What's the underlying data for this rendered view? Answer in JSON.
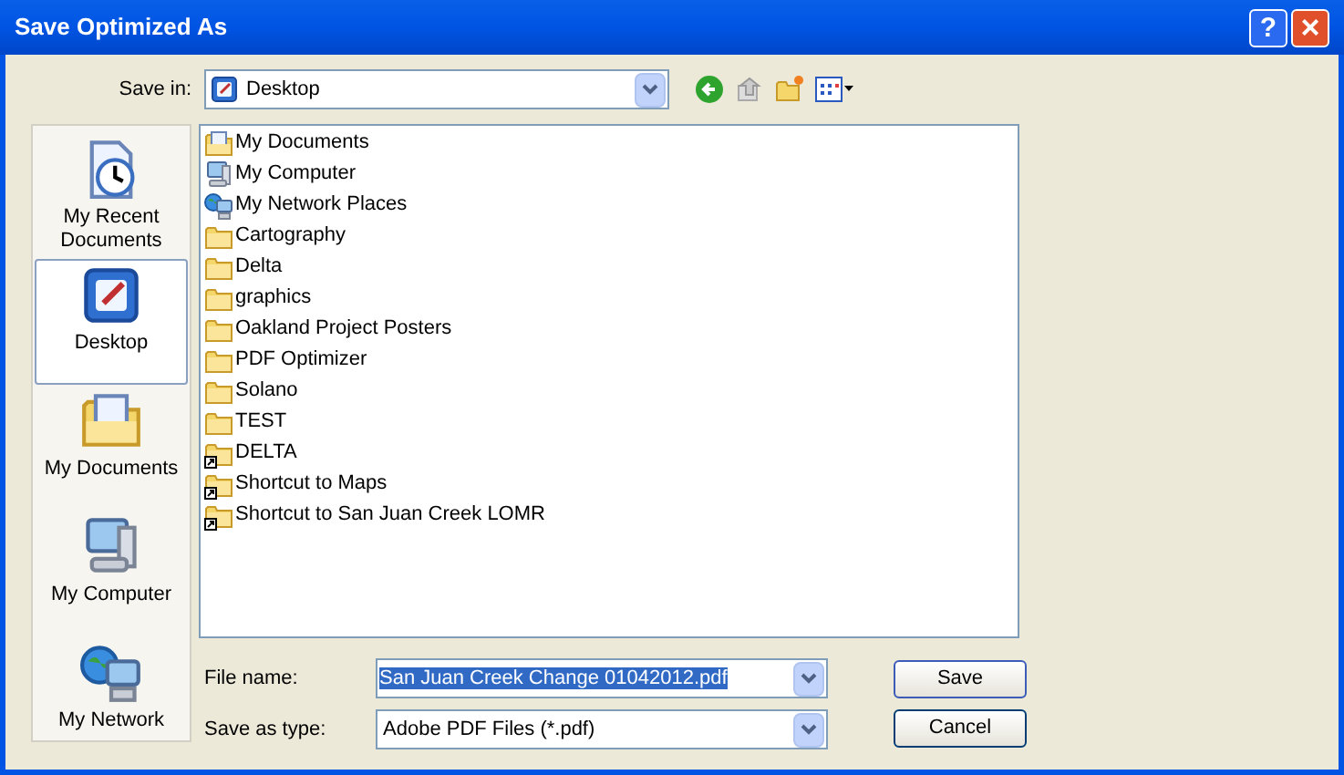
{
  "window": {
    "title": "Save Optimized As",
    "buttons": [
      {
        "kind": "help",
        "label": "?"
      },
      {
        "kind": "close",
        "label": "×"
      }
    ]
  },
  "save_in": {
    "label": "Save in:",
    "value": "Desktop"
  },
  "places": [
    {
      "label": "My Recent Documents",
      "kind": "recent",
      "selected": false
    },
    {
      "label": "Desktop",
      "kind": "desktop",
      "selected": true
    },
    {
      "label": "My Documents",
      "kind": "documents",
      "selected": false
    },
    {
      "label": "My Computer",
      "kind": "computer",
      "selected": false
    },
    {
      "label": "My Network",
      "kind": "network",
      "selected": false
    }
  ],
  "files": [
    {
      "name": "My Documents",
      "kind": "documents"
    },
    {
      "name": "My Computer",
      "kind": "computer"
    },
    {
      "name": "My Network Places",
      "kind": "network"
    },
    {
      "name": "Cartography",
      "kind": "folder"
    },
    {
      "name": "Delta",
      "kind": "folder"
    },
    {
      "name": "graphics",
      "kind": "folder"
    },
    {
      "name": "Oakland Project Posters",
      "kind": "folder"
    },
    {
      "name": "PDF Optimizer",
      "kind": "folder"
    },
    {
      "name": "Solano",
      "kind": "folder"
    },
    {
      "name": "TEST",
      "kind": "folder"
    },
    {
      "name": "DELTA",
      "kind": "shortcut"
    },
    {
      "name": "Shortcut to Maps",
      "kind": "shortcut"
    },
    {
      "name": "Shortcut to San Juan Creek LOMR",
      "kind": "shortcut"
    }
  ],
  "file_name": {
    "label": "File name:",
    "value": "San Juan Creek Change 01042012.pdf",
    "selected": true
  },
  "save_as_type": {
    "label": "Save as type:",
    "value": "Adobe PDF Files (*.pdf)"
  },
  "actions": [
    "Save",
    "Cancel"
  ]
}
